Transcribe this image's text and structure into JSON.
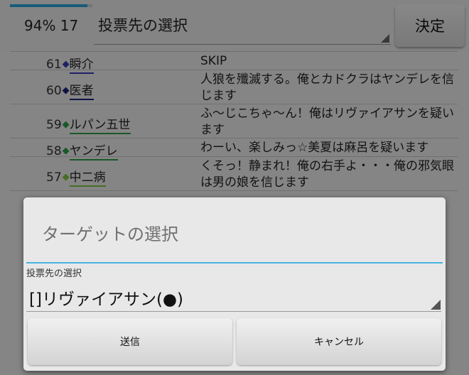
{
  "header": {
    "status_text": "94% 17",
    "progress_percent": 94,
    "progress_color": "#2aa4d8",
    "vote_target_label": "投票先の選択",
    "decide_label": "決定"
  },
  "log": {
    "rows": [
      {
        "number": "61",
        "diamond": "◆",
        "diamond_color": "#3a3ab8",
        "name": "瞬介",
        "underline_color": "#3a3ab8",
        "message": "SKIP"
      },
      {
        "number": "60",
        "diamond": "◆",
        "diamond_color": "#1a237e",
        "name": "医者",
        "underline_color": "#1a237e",
        "message": "人狼を殲滅する。俺とカドクラはヤンデレを信じます"
      },
      {
        "number": "59",
        "diamond": "◆",
        "diamond_color": "#2e9d4a",
        "name": "ルパン五世",
        "underline_color": "#2e9d4a",
        "message": "ふ〜じこちゃ〜ん！俺はリヴァイアサンを疑います"
      },
      {
        "number": "58",
        "diamond": "◆",
        "diamond_color": "#2e9d4a",
        "name": "ヤンデレ",
        "underline_color": "#2e9d4a",
        "message": "わーい、楽しみっ☆美夏は麻呂を疑います"
      },
      {
        "number": "57",
        "diamond": "◆",
        "diamond_color": "#7cc242",
        "name": "中二病",
        "underline_color": "#7cc242",
        "message": "くそっ！静まれ！俺の右手よ・・・俺の邪気眼は男の娘を信じます"
      }
    ]
  },
  "dialog": {
    "title": "ターゲットの選択",
    "accent_color": "#46b3e0",
    "field_label": "投票先の選択",
    "selected_value": "[]リヴァイアサン(●)",
    "send_label": "送信",
    "cancel_label": "キャンセル"
  }
}
